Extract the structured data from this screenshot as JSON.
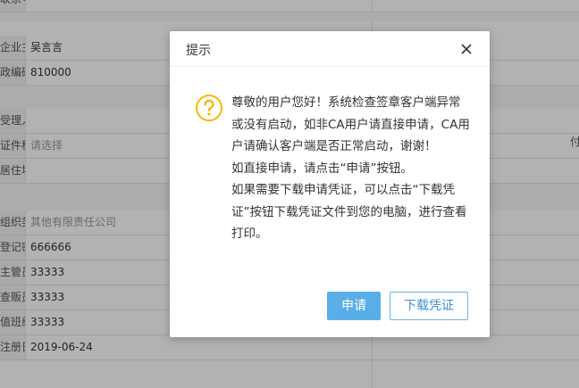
{
  "form": {
    "rows": [
      {
        "label": "联系号",
        "value": ""
      },
      {
        "label": "企业主)",
        "value": "吴言言"
      },
      {
        "label": "政编码",
        "value": "810000"
      },
      {
        "label": "受理人",
        "value": ""
      },
      {
        "label": "证件种类",
        "value": "请选择"
      },
      {
        "label": "居住址",
        "value": ""
      },
      {
        "label": "组织类型",
        "value": "其他有限责任公司"
      },
      {
        "label": "登记密员",
        "value": "666666"
      },
      {
        "label": "主管员",
        "value": "33333"
      },
      {
        "label": "查贩员",
        "value": "33333"
      },
      {
        "label": "值班组",
        "value": "33333"
      },
      {
        "label": "注册日期",
        "value": "2019-06-24"
      }
    ],
    "right_edge_text": "付"
  },
  "dialog": {
    "title": "提示",
    "message": [
      "尊敬的用户您好！系统检查签章客户端异常或没有启动，如非CA用户请直接申请，CA用户请确认客户端是否正常启动，谢谢！",
      "如直接申请，请点击“申请”按钮。",
      "如果需要下载申请凭证，可以点击“下载凭证”按钮下载凭证文件到您的电脑，进行查看打印。"
    ],
    "apply_label": "申请",
    "download_label": "下载凭证"
  },
  "colors": {
    "accent": "#5aaee8",
    "warning": "#f5b800",
    "overlay": "rgba(0,0,0,0.3)"
  },
  "icons": {
    "warning": "question-circle-icon",
    "close": "close-icon"
  }
}
